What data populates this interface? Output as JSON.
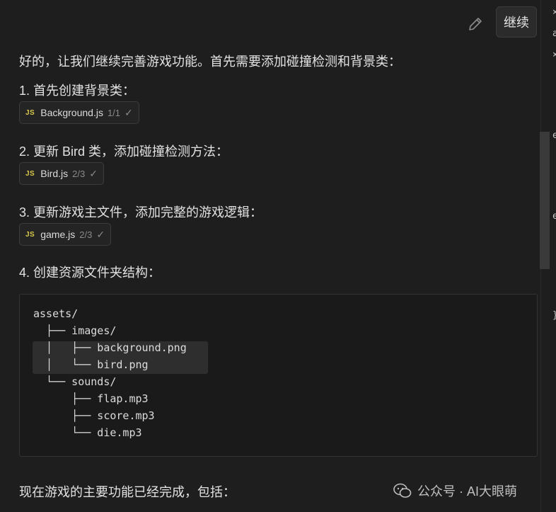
{
  "header": {
    "continue_label": "继续"
  },
  "message": {
    "intro": "好的，让我们继续完善游戏功能。首先需要添加碰撞检测和背景类：",
    "steps": [
      {
        "text": "1. 首先创建背景类：",
        "file": {
          "badge": "JS",
          "name": "Background.js",
          "count": "1/1",
          "check": "✓"
        }
      },
      {
        "text": "2. 更新 Bird 类，添加碰撞检测方法：",
        "file": {
          "badge": "JS",
          "name": "Bird.js",
          "count": "2/3",
          "check": "✓"
        }
      },
      {
        "text": "3. 更新游戏主文件，添加完整的游戏逻辑：",
        "file": {
          "badge": "JS",
          "name": "game.js",
          "count": "2/3",
          "check": "✓"
        }
      },
      {
        "text": "4. 创建资源文件夹结构："
      }
    ],
    "code_lines": [
      "assets/",
      "  ├── images/",
      "  │   ├── background.png",
      "  │   └── bird.png",
      "  └── sounds/",
      "      ├── flap.mp3",
      "      ├── score.mp3",
      "      └── die.mp3"
    ],
    "outro": "现在游戏的主要功能已经完成，包括："
  },
  "watermark": {
    "text": "公众号 · AI大眼萌"
  },
  "edge_glyphs": [
    "×",
    "a",
    "×",
    "e",
    "e",
    "{",
    "}"
  ],
  "colors": {
    "background": "#1e1e1e",
    "js_badge": "#d9c84a",
    "chip_border": "#3b3b3b"
  }
}
